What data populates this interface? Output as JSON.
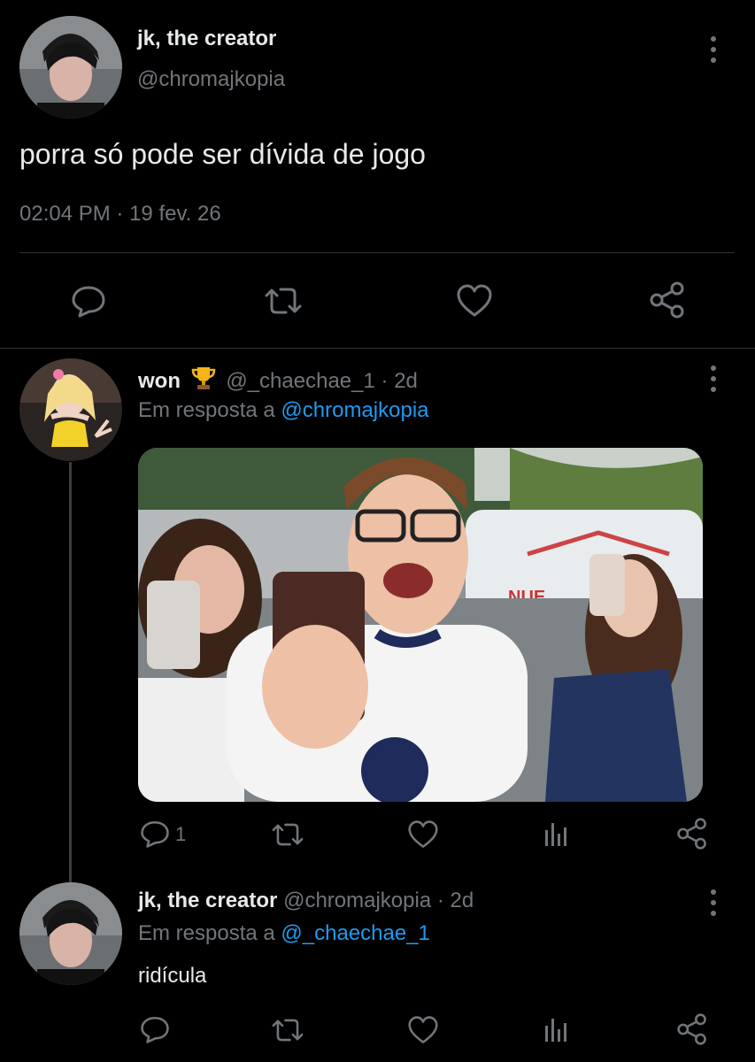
{
  "main_tweet": {
    "display_name": "jk, the creator",
    "handle": "@chromajkopia",
    "text": "porra só pode ser dívida de jogo",
    "time": "02:04 PM",
    "separator": "·",
    "date": "19 fev. 26"
  },
  "reply1": {
    "display_name": "won",
    "badge_icon": "trophy-icon",
    "handle": "@_chaechae_1",
    "separator": "·",
    "age": "2d",
    "reply_to_prefix": "Em resposta a",
    "reply_to_handle": "@chromajkopia",
    "media_icon": "photo-media",
    "reply_count": "1"
  },
  "reply2": {
    "display_name": "jk, the creator",
    "handle": "@chromajkopia",
    "separator": "·",
    "age": "2d",
    "reply_to_prefix": "Em resposta a",
    "reply_to_handle": "@_chaechae_1",
    "text": "ridícula"
  },
  "colors": {
    "background": "#000000",
    "text": "#e7e9ea",
    "muted": "#71767b",
    "link": "#1d9bf0",
    "divider": "#2f3336"
  }
}
